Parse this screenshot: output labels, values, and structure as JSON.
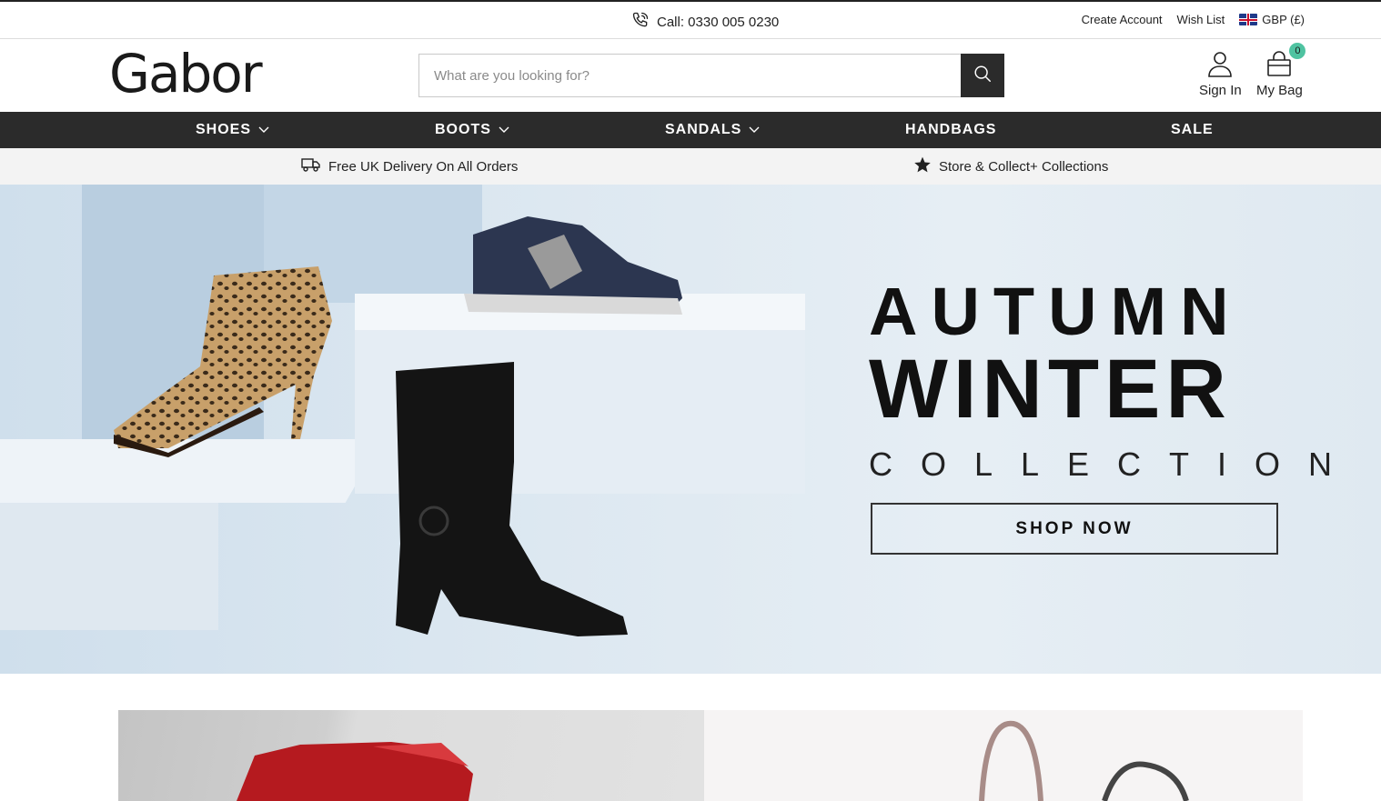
{
  "topbar": {
    "phone_label": "Call: 0330 005 0230",
    "create_account": "Create Account",
    "wish_list": "Wish List",
    "currency": "GBP (£)"
  },
  "header": {
    "logo": "Gabor",
    "search_placeholder": "What are you looking for?",
    "sign_in": "Sign In",
    "my_bag": "My Bag",
    "bag_count": "0",
    "badge_color": "#4fc3a1"
  },
  "nav": {
    "items": [
      {
        "label": "SHOES",
        "has_dropdown": true
      },
      {
        "label": "BOOTS",
        "has_dropdown": true
      },
      {
        "label": "SANDALS",
        "has_dropdown": true
      },
      {
        "label": "HANDBAGS",
        "has_dropdown": false
      },
      {
        "label": "SALE",
        "has_dropdown": false
      }
    ]
  },
  "info_strip": {
    "delivery": "Free UK Delivery On All Orders",
    "collect": "Store & Collect+ Collections"
  },
  "hero": {
    "line1": "AUTUMN",
    "line2": "WINTER",
    "line3": "COLLECTION",
    "cta": "SHOP NOW"
  },
  "colors": {
    "nav_bg": "#2b2b2b",
    "strip_bg": "#f3f3f3",
    "hero_bg": "#dde8f1"
  }
}
